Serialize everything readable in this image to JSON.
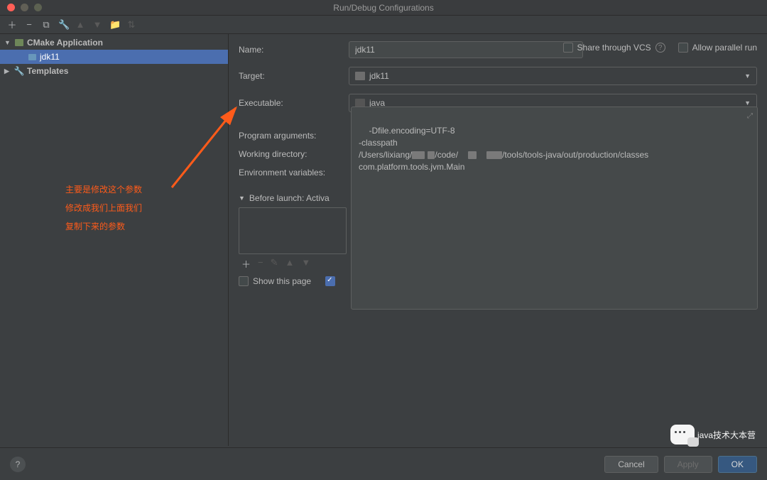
{
  "window": {
    "title": "Run/Debug Configurations"
  },
  "sidebar": {
    "group": "CMake Application",
    "item": "jdk11",
    "templates": "Templates"
  },
  "form": {
    "name_label": "Name:",
    "name_value": "jdk11",
    "share_label": "Share through VCS",
    "parallel_label": "Allow parallel run",
    "target_label": "Target:",
    "target_value": "jdk11",
    "exec_label": "Executable:",
    "exec_value": "java",
    "args_label": "Program arguments:",
    "wd_label": "Working directory:",
    "env_label": "Environment variables:",
    "args_text": "-Dfile.encoding=UTF-8\n-classpath\n/Users/lixiang/",
    "args_mid": "/code/",
    "args_mid2": "/tools/tools-java/out/production",
    "args_tail": "/classes\ncom.platform.tools.jvm.Main"
  },
  "before": {
    "header": "Before launch: Activa",
    "show_page": "Show this page"
  },
  "annotation": {
    "line1": "主要是修改这个参数",
    "line2": "修改成我们上面我们",
    "line3": "复制下来的参数"
  },
  "buttons": {
    "cancel": "Cancel",
    "apply": "Apply",
    "ok": "OK"
  },
  "watermark": "java技术大本营"
}
